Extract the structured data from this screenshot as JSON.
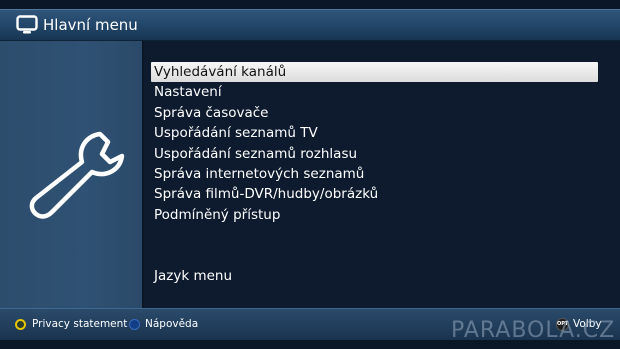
{
  "header": {
    "title": "Hlavní menu",
    "icon": "tv-icon"
  },
  "left_panel": {
    "icon": "wrench-icon"
  },
  "menu": {
    "items": [
      {
        "label": "Vyhledávání kanálů",
        "selected": true
      },
      {
        "label": "Nastavení",
        "selected": false
      },
      {
        "label": "Správa časovače",
        "selected": false
      },
      {
        "label": "Uspořádání seznamů TV",
        "selected": false
      },
      {
        "label": "Uspořádání seznamů rozhlasu",
        "selected": false
      },
      {
        "label": "Správa internetových seznamů",
        "selected": false
      },
      {
        "label": "Správa filmů-DVR/hudby/obrázků",
        "selected": false
      },
      {
        "label": "Podmíněný přístup",
        "selected": false
      }
    ],
    "language_item": "Jazyk menu"
  },
  "footer": {
    "yellow_hint": "Privacy statement",
    "blue_hint": "Nápověda",
    "opt_badge": "OPT",
    "opt_hint": "Volby",
    "colors": {
      "yellow_button": "#e7c400",
      "blue_button": "#123e86"
    }
  },
  "watermark": "PARABOLA.CZ",
  "colors": {
    "header_bar": "#23476a",
    "left_panel": "#2f5173",
    "menu_background": "#0e1b2e",
    "selection": "#e8e8e8"
  }
}
